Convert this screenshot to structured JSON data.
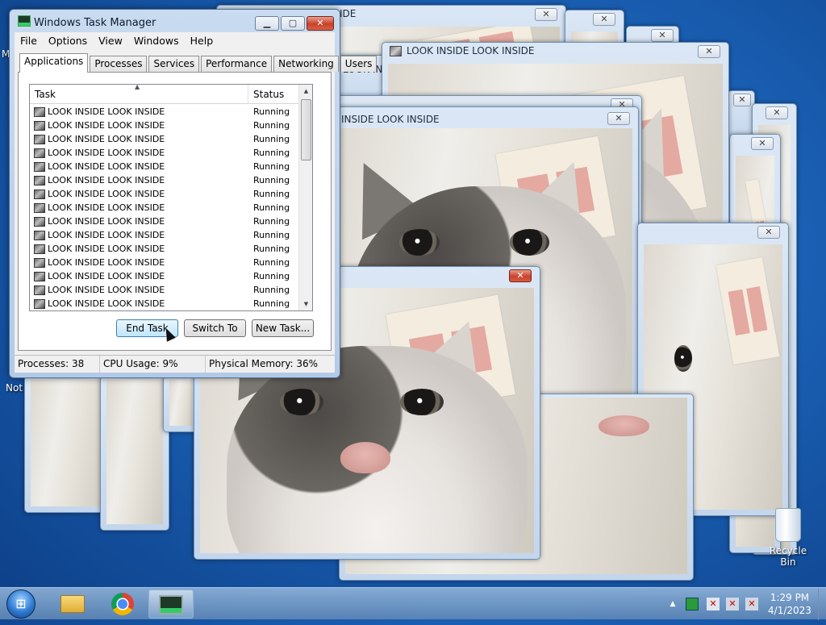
{
  "colors": {
    "desktop": "#1a5fb3",
    "title_close_red": "#c8412a",
    "selected_button": "#bee6fd"
  },
  "desktop": {
    "cut_label_left": "Not",
    "cut_label_top": "M",
    "recycle_bin_label": "Recycle Bin"
  },
  "cat_windows": {
    "title": "LOOK INSIDE LOOK INSIDE",
    "title_partial_a": "INSIDE LOOK INSIDE",
    "title_partial_b": "IDE",
    "title_partial_c": "LOOK INS",
    "close_glyph": "✕"
  },
  "task_manager": {
    "title": "Windows Task Manager",
    "caption_buttons": {
      "minimize": "▁",
      "maximize": "▢",
      "close": "✕"
    },
    "menu": [
      "File",
      "Options",
      "View",
      "Windows",
      "Help"
    ],
    "tabs": [
      "Applications",
      "Processes",
      "Services",
      "Performance",
      "Networking",
      "Users"
    ],
    "active_tab": "Applications",
    "columns": {
      "task": "Task",
      "status": "Status"
    },
    "sort_glyph": "▲",
    "rows": [
      {
        "task": "LOOK INSIDE LOOK INSIDE",
        "status": "Running"
      },
      {
        "task": "LOOK INSIDE LOOK INSIDE",
        "status": "Running"
      },
      {
        "task": "LOOK INSIDE LOOK INSIDE",
        "status": "Running"
      },
      {
        "task": "LOOK INSIDE LOOK INSIDE",
        "status": "Running"
      },
      {
        "task": "LOOK INSIDE LOOK INSIDE",
        "status": "Running"
      },
      {
        "task": "LOOK INSIDE LOOK INSIDE",
        "status": "Running"
      },
      {
        "task": "LOOK INSIDE LOOK INSIDE",
        "status": "Running"
      },
      {
        "task": "LOOK INSIDE LOOK INSIDE",
        "status": "Running"
      },
      {
        "task": "LOOK INSIDE LOOK INSIDE",
        "status": "Running"
      },
      {
        "task": "LOOK INSIDE LOOK INSIDE",
        "status": "Running"
      },
      {
        "task": "LOOK INSIDE LOOK INSIDE",
        "status": "Running"
      },
      {
        "task": "LOOK INSIDE LOOK INSIDE",
        "status": "Running"
      },
      {
        "task": "LOOK INSIDE LOOK INSIDE",
        "status": "Running"
      },
      {
        "task": "LOOK INSIDE LOOK INSIDE",
        "status": "Running"
      },
      {
        "task": "LOOK INSIDE LOOK INSIDE",
        "status": "Running"
      }
    ],
    "buttons": {
      "end_task": "End Task",
      "switch_to": "Switch To",
      "new_task": "New Task..."
    },
    "status_bar": {
      "processes": "Processes: 38",
      "cpu": "CPU Usage: 9%",
      "memory": "Physical Memory: 36%"
    }
  },
  "taskbar": {
    "start_glyph": "⊞",
    "tray": {
      "arrow": "▲",
      "flag_x": "✕",
      "net_x": "✕",
      "vol_x": "✕"
    },
    "clock": {
      "time": "1:29 PM",
      "date": "4/1/2023"
    }
  }
}
